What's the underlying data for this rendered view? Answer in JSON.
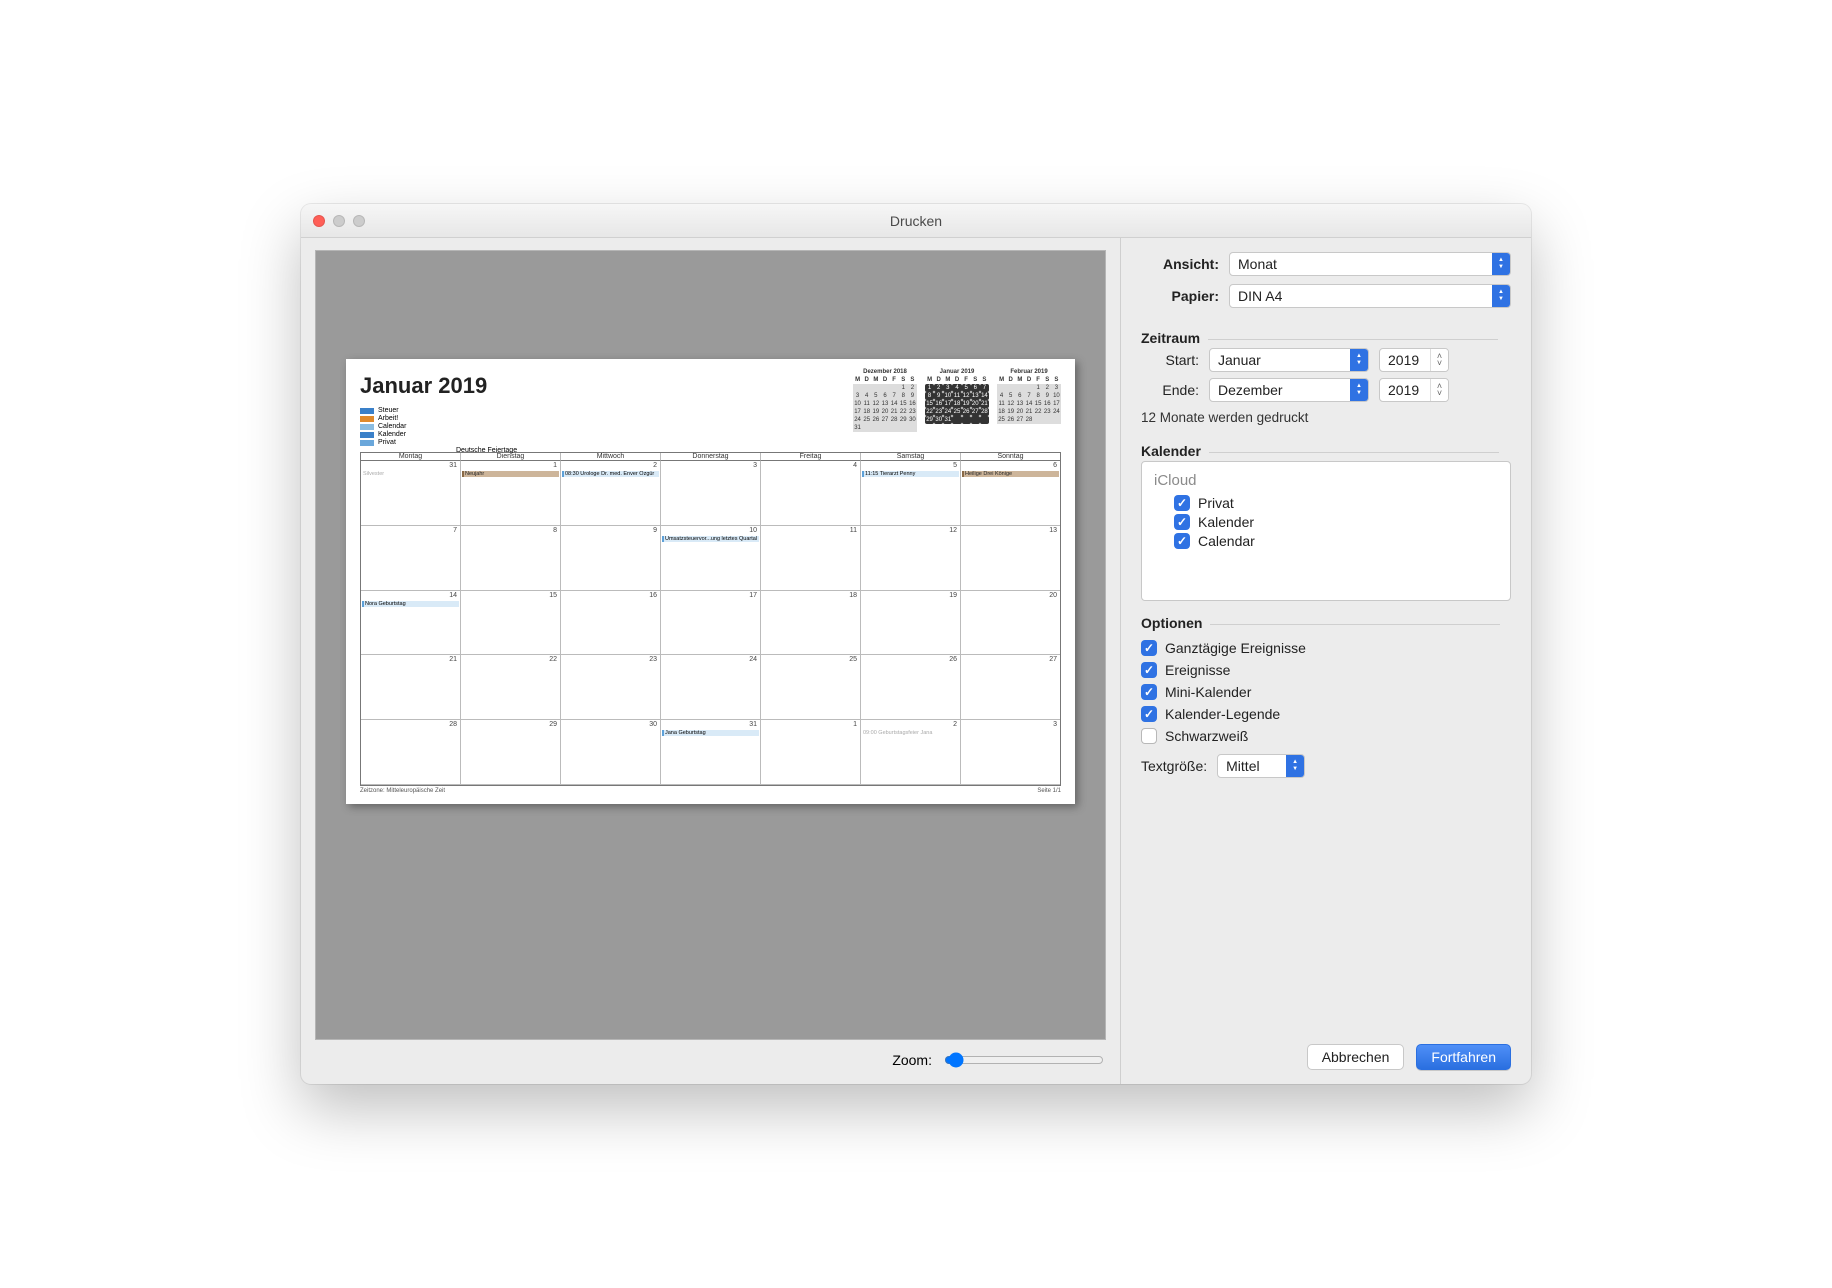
{
  "window": {
    "title": "Drucken"
  },
  "form": {
    "view_label": "Ansicht:",
    "view_value": "Monat",
    "paper_label": "Papier:",
    "paper_value": "DIN A4"
  },
  "zeitraum": {
    "title": "Zeitraum",
    "start_label": "Start:",
    "start_month": "Januar",
    "start_year": "2019",
    "end_label": "Ende:",
    "end_month": "Dezember",
    "end_year": "2019",
    "status": "12 Monate werden gedruckt"
  },
  "kalender": {
    "title": "Kalender",
    "group": "iCloud",
    "items": [
      {
        "label": "Privat",
        "checked": true
      },
      {
        "label": "Kalender",
        "checked": true
      },
      {
        "label": "Calendar",
        "checked": true
      }
    ]
  },
  "optionen": {
    "title": "Optionen",
    "items": [
      {
        "label": "Ganztägige Ereignisse",
        "checked": true
      },
      {
        "label": "Ereignisse",
        "checked": true
      },
      {
        "label": "Mini-Kalender",
        "checked": true
      },
      {
        "label": "Kalender-Legende",
        "checked": true
      },
      {
        "label": "Schwarzweiß",
        "checked": false
      }
    ],
    "text_size_label": "Textgröße:",
    "text_size_value": "Mittel"
  },
  "buttons": {
    "cancel": "Abbrechen",
    "continue": "Fortfahren"
  },
  "zoom": {
    "label": "Zoom:"
  },
  "preview": {
    "month_title": "Januar 2019",
    "legend": [
      {
        "color": "#3a80c9",
        "label": "Steuer"
      },
      {
        "color": "#e08a2c",
        "label": "Arbeit!"
      },
      {
        "color": "#8bbce0",
        "label": "Calendar"
      },
      {
        "color": "#3a80c9",
        "label": "Kalender"
      },
      {
        "color": "#6aa7db",
        "label": "Privat"
      }
    ],
    "legend_extra": {
      "color": "#8a6a47",
      "label": "Deutsche Feiertage"
    },
    "weekdays": [
      "Montag",
      "Dienstag",
      "Mittwoch",
      "Donnerstag",
      "Freitag",
      "Samstag",
      "Sonntag"
    ],
    "footer_left": "Zeitzone: Mitteleuropäische Zeit",
    "footer_right": "Seite 1/1",
    "minicals": [
      "Dezember 2018",
      "Januar 2019",
      "Februar 2019"
    ],
    "rows": [
      {
        "nums": [
          "31",
          "1",
          "2",
          "3",
          "4",
          "5",
          "6"
        ],
        "events": [
          {
            "day": 0,
            "text": "Silvester",
            "type": "gray"
          },
          {
            "day": 1,
            "text": "Neujahr",
            "type": "full"
          },
          {
            "day": 2,
            "text": "08:30 Urologe Dr. med. Enver Özgür",
            "type": "ev"
          },
          {
            "day": 5,
            "text": "11:15 Tierarzt Penny",
            "type": "ev"
          },
          {
            "day": 6,
            "text": "Heilige Drei Könige",
            "type": "full"
          }
        ]
      },
      {
        "nums": [
          "7",
          "8",
          "9",
          "10",
          "11",
          "12",
          "13"
        ],
        "events": [
          {
            "day": 3,
            "text": "Umsatzsteuervor...ung letztes Quartal",
            "type": "ev"
          }
        ]
      },
      {
        "nums": [
          "14",
          "15",
          "16",
          "17",
          "18",
          "19",
          "20"
        ],
        "events": [
          {
            "day": 0,
            "text": "Nora Geburtstag",
            "type": "ev"
          }
        ]
      },
      {
        "nums": [
          "21",
          "22",
          "23",
          "24",
          "25",
          "26",
          "27"
        ],
        "events": []
      },
      {
        "nums": [
          "28",
          "29",
          "30",
          "31",
          "1",
          "2",
          "3"
        ],
        "events": [
          {
            "day": 3,
            "text": "Jana Geburtstag",
            "type": "ev"
          },
          {
            "day": 5,
            "text": "09:00 Geburtstagsfeier Jana",
            "type": "gray"
          }
        ]
      }
    ]
  }
}
